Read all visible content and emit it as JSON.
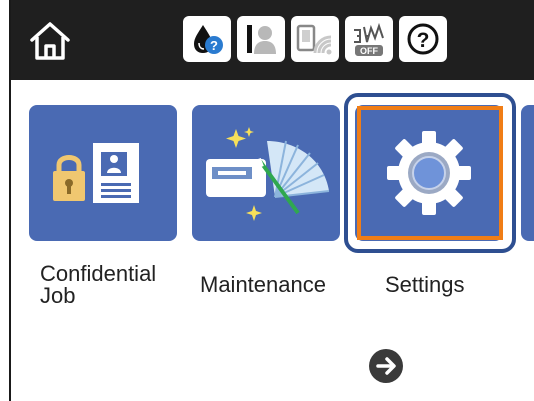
{
  "tiles": [
    {
      "id": "confidential-job",
      "label": "Confidential\nJob",
      "icon": "confidential-job-icon"
    },
    {
      "id": "maintenance",
      "label": "Maintenance",
      "icon": "maintenance-icon"
    },
    {
      "id": "settings",
      "label": "Settings",
      "icon": "gear-icon",
      "selected": true
    }
  ],
  "colors": {
    "topbar": "#1f1f1f",
    "tile": "#4a6ab3",
    "selection_border": "#2e4f91",
    "selection_inner": "#f07d16"
  },
  "status_icons": [
    "ink-help-icon",
    "fax-status-icon",
    "wifi-status-icon",
    "wifi-direct-off-icon",
    "help-icon"
  ],
  "status_text": {
    "wifi_direct": "OFF",
    "help": "?"
  }
}
